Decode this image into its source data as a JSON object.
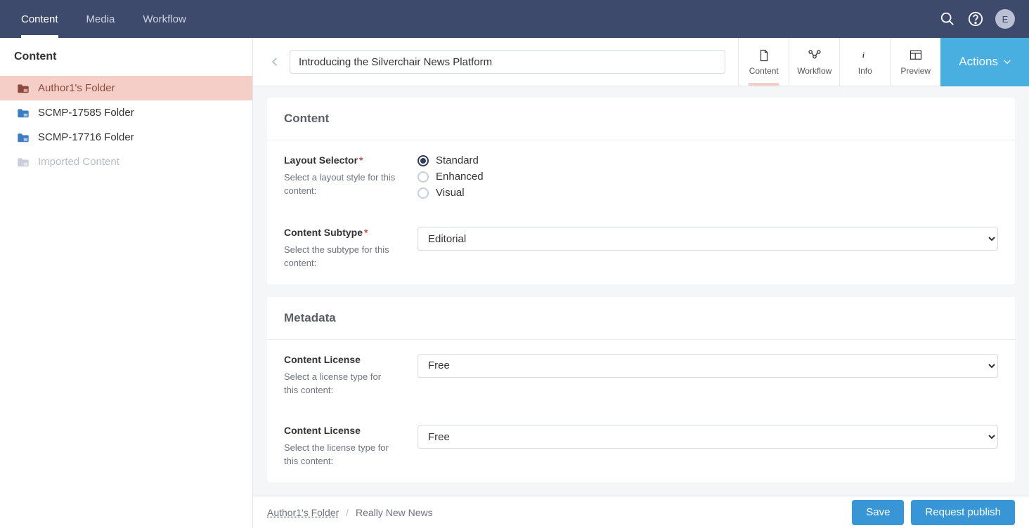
{
  "topbar": {
    "tabs": [
      {
        "label": "Content",
        "active": true
      },
      {
        "label": "Media",
        "active": false
      },
      {
        "label": "Workflow",
        "active": false
      }
    ],
    "avatar": "E"
  },
  "sidebar": {
    "title": "Content",
    "items": [
      {
        "label": "Author1's Folder",
        "state": "active"
      },
      {
        "label": "SCMP-17585 Folder",
        "state": "normal"
      },
      {
        "label": "SCMP-17716 Folder",
        "state": "normal"
      },
      {
        "label": "Imported Content",
        "state": "disabled"
      }
    ]
  },
  "editor": {
    "title_value": "Introducing the Silverchair News Platform",
    "tool_tabs": [
      {
        "label": "Content",
        "active": true
      },
      {
        "label": "Workflow",
        "active": false
      },
      {
        "label": "Info",
        "active": false
      },
      {
        "label": "Preview",
        "active": false
      }
    ],
    "actions_label": "Actions"
  },
  "card_content": {
    "heading": "Content",
    "layout_selector": {
      "label": "Layout Selector",
      "required": true,
      "help": "Select a layout style for this content:",
      "options": [
        {
          "label": "Standard",
          "checked": true
        },
        {
          "label": "Enhanced",
          "checked": false
        },
        {
          "label": "Visual",
          "checked": false
        }
      ]
    },
    "content_subtype": {
      "label": "Content Subtype",
      "required": true,
      "help": "Select the subtype for this content:",
      "selected": "Editorial"
    }
  },
  "card_metadata": {
    "heading": "Metadata",
    "license_a": {
      "label": "Content License",
      "help": "Select a license type for this content:",
      "selected": "Free"
    },
    "license_b": {
      "label": "Content License",
      "help": "Select the license type for this content:",
      "selected": "Free"
    }
  },
  "footer": {
    "breadcrumb_link": "Author1's Folder",
    "breadcrumb_current": "Really New News",
    "save_label": "Save",
    "publish_label": "Request publish"
  }
}
